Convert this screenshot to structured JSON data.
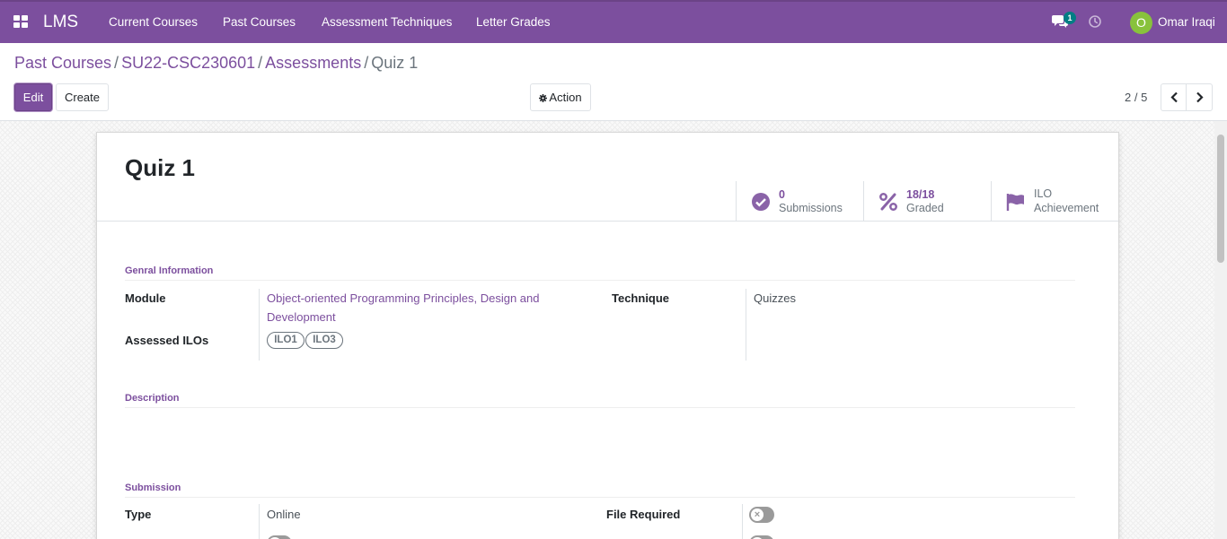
{
  "navbar": {
    "brand": "LMS",
    "menu": [
      {
        "label": "Current Courses"
      },
      {
        "label": "Past Courses"
      },
      {
        "label": "Assessment Techniques"
      },
      {
        "label": "Letter Grades"
      }
    ],
    "messages_count": "1",
    "user": {
      "initial": "O",
      "name": "Omar Iraqi"
    },
    "colors": {
      "primary": "#7c4f9e",
      "badge": "#017e84",
      "avatar": "#88c23c"
    }
  },
  "breadcrumb": {
    "items": [
      {
        "label": "Past Courses"
      },
      {
        "label": "SU22-CSC230601"
      },
      {
        "label": "Assessments"
      }
    ],
    "current": "Quiz 1",
    "separator": "/"
  },
  "control_panel": {
    "edit_label": "Edit",
    "create_label": "Create",
    "action_label": "Action",
    "pager": "2 / 5"
  },
  "record": {
    "title": "Quiz 1",
    "stats": [
      {
        "value": "0",
        "label": "Submissions",
        "icon": "check-circle-icon"
      },
      {
        "value": "18/18",
        "label": "Graded",
        "icon": "percent-icon"
      },
      {
        "label_line1": "ILO",
        "label_line2": "Achievement",
        "icon": "flag-icon"
      }
    ],
    "sections": {
      "general": {
        "title": "Genral Information",
        "module_label": "Module",
        "module_value_line1": "Object-oriented Programming Principles, Design and",
        "module_value_line2": "Development",
        "technique_label": "Technique",
        "technique_value": "Quizzes",
        "ilos_label": "Assessed ILOs",
        "ilos": [
          "ILO1",
          "ILO3"
        ]
      },
      "description": {
        "title": "Description"
      },
      "submission": {
        "title": "Submission",
        "type_label": "Type",
        "type_value": "Online",
        "file_required_label": "File Required",
        "file_required": false
      }
    }
  }
}
